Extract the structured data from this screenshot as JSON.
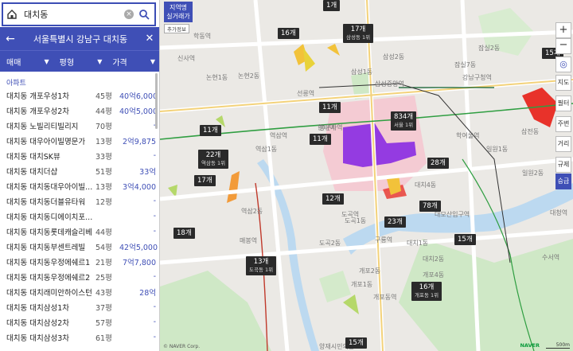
{
  "search": {
    "query": "대치동"
  },
  "region": {
    "title": "서울특별시 강남구 대치동"
  },
  "filters": [
    {
      "label": "매매"
    },
    {
      "label": "평형"
    },
    {
      "label": "가격"
    }
  ],
  "list": {
    "section": "아파트",
    "rows": [
      {
        "name": "대치동 개포우성1차",
        "area": "45평",
        "price": "40억6,000"
      },
      {
        "name": "대치동 개포우성2차",
        "area": "44평",
        "price": "40억5,000"
      },
      {
        "name": "대치동 노빌리티빌리지",
        "area": "70평",
        "price": "-"
      },
      {
        "name": "대치동 대우아이빌명문가",
        "area": "13평",
        "price": "2억9,875"
      },
      {
        "name": "대치동 대치SK뷰",
        "area": "33평",
        "price": "-"
      },
      {
        "name": "대치동 대치더샵",
        "area": "51평",
        "price": "33억"
      },
      {
        "name": "대치동 대치동대우아이빌...",
        "area": "13평",
        "price": "3억4,000"
      },
      {
        "name": "대치동 대치동더블유타워",
        "area": "12평",
        "price": "-"
      },
      {
        "name": "대치동 대치동디에이치포...",
        "area": "",
        "price": "-"
      },
      {
        "name": "대치동 대치동롯데캐슬리베",
        "area": "44평",
        "price": "-"
      },
      {
        "name": "대치동 대치동부센트레빌",
        "area": "54평",
        "price": "42억5,000"
      },
      {
        "name": "대치동 대치동우정에쉐르1",
        "area": "21평",
        "price": "7억7,800"
      },
      {
        "name": "대치동 대치동우정에쉐르2",
        "area": "25평",
        "price": "-"
      },
      {
        "name": "대치동 대치래미안하이스턴",
        "area": "43평",
        "price": "28억"
      },
      {
        "name": "대치동 대치삼성1차",
        "area": "37평",
        "price": "-"
      },
      {
        "name": "대치동 대치삼성2차",
        "area": "57평",
        "price": "-"
      },
      {
        "name": "대치동 대치삼성3차",
        "area": "61평",
        "price": "-"
      }
    ]
  },
  "map": {
    "top_button": "지역명\n실거래가",
    "top_sub": "추가정보",
    "controls": {
      "zoom_in": "+",
      "zoom_out": "−",
      "jido": "지도",
      "bunjok": "필터",
      "jubyeon": "주변",
      "geori": "거리",
      "gyujae": "규제",
      "seunggeup": "승급"
    },
    "attribution": "© NAVER Corp.",
    "brand": "NAVER",
    "scale": "500m",
    "counts": [
      {
        "text": "1개",
        "sub": ""
      },
      {
        "text": "16개",
        "sub": ""
      },
      {
        "text": "17개",
        "sub": "삼성동 1위"
      },
      {
        "text": "15개",
        "sub": ""
      },
      {
        "text": "11개",
        "sub": ""
      },
      {
        "text": "834개",
        "sub": "서울 1위"
      },
      {
        "text": "11개",
        "sub": ""
      },
      {
        "text": "22개",
        "sub": "역삼동 1위"
      },
      {
        "text": "11개",
        "sub": ""
      },
      {
        "text": "28개",
        "sub": ""
      },
      {
        "text": "17개",
        "sub": ""
      },
      {
        "text": "12개",
        "sub": ""
      },
      {
        "text": "78개",
        "sub": ""
      },
      {
        "text": "18개",
        "sub": ""
      },
      {
        "text": "23개",
        "sub": ""
      },
      {
        "text": "15개",
        "sub": ""
      },
      {
        "text": "13개",
        "sub": "도곡동 1위"
      },
      {
        "text": "16개",
        "sub": "개포동 1위"
      },
      {
        "text": "15개",
        "sub": ""
      }
    ],
    "places": [
      "학동역",
      "논현1동",
      "논현2동",
      "삼성1동",
      "삼성2동",
      "선릉역",
      "삼성중앙역",
      "봉은사역",
      "역삼1동",
      "역삼2동",
      "대치1동",
      "대치2동",
      "대치4동",
      "도곡1동",
      "도곡2동",
      "개포1동",
      "개포2동",
      "개포4동",
      "일원1동",
      "일원2동",
      "잠실7동",
      "잠실2동",
      "삼전동",
      "대모산입구역",
      "한티역",
      "도곡역",
      "매봉역",
      "구룡역",
      "개포동역",
      "학여울역",
      "양재시민의숲",
      "대청역",
      "역삼역",
      "강남구청역",
      "신사역",
      "수서역"
    ]
  },
  "colors": {
    "accent": "#3f4fb6",
    "highlight": "#8a2be2",
    "zone": "#f6c6d0",
    "hot": "#e8322a"
  }
}
